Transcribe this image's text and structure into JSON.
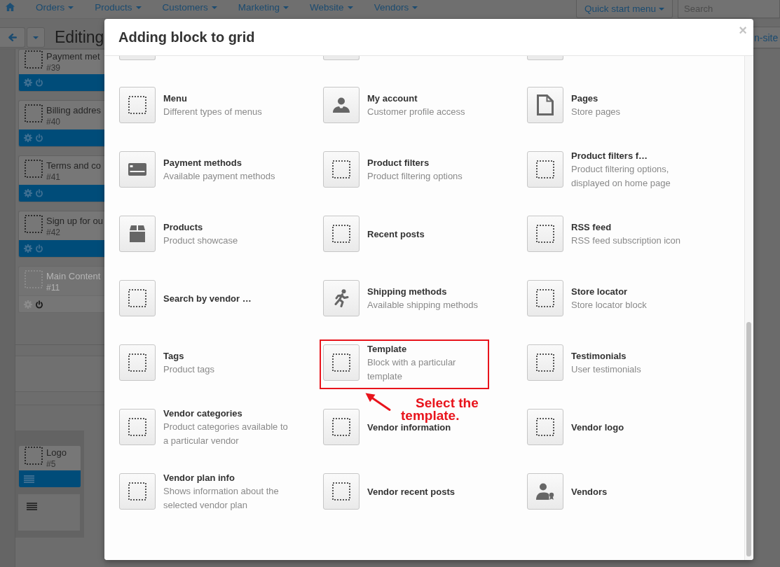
{
  "top_nav": {
    "menu": [
      {
        "label": "Orders"
      },
      {
        "label": "Products"
      },
      {
        "label": "Customers"
      },
      {
        "label": "Marketing"
      },
      {
        "label": "Website"
      },
      {
        "label": "Vendors"
      }
    ],
    "quick_start_menu": "Quick start menu",
    "search": {
      "placeholder": "Search"
    }
  },
  "toolbar": {
    "title": "Editing",
    "right_button": "n-site"
  },
  "layout_blocks": [
    {
      "title": "Payment met",
      "number": "#39",
      "enabled": true
    },
    {
      "title": "Billing addres",
      "number": "#40",
      "enabled": true
    },
    {
      "title": "Terms and co",
      "number": "#41",
      "enabled": true
    },
    {
      "title": "Sign up for ou",
      "number": "#42",
      "enabled": true
    },
    {
      "title": "Main Content",
      "number": "#11",
      "enabled": false
    }
  ],
  "footer_blocks": [
    {
      "title": "Logo",
      "number": "#5"
    }
  ],
  "dialog": {
    "title": "Adding block to grid",
    "close": "×",
    "blocks": [
      {
        "title": "Menu",
        "description": "Different types of menus",
        "kind": "placeholder",
        "highlighted": false
      },
      {
        "title": "My account",
        "description": "Customer profile access",
        "kind": "person",
        "highlighted": false
      },
      {
        "title": "Pages",
        "description": "Store pages",
        "kind": "page",
        "highlighted": false
      },
      {
        "title": "Payment methods",
        "description": "Available payment methods",
        "kind": "card",
        "highlighted": false
      },
      {
        "title": "Product filters",
        "description": "Product filtering options",
        "kind": "placeholder",
        "highlighted": false
      },
      {
        "title": "Product filters f…",
        "description": "Product filtering options, displayed on home page",
        "kind": "placeholder",
        "highlighted": false
      },
      {
        "title": "Products",
        "description": "Product showcase",
        "kind": "box",
        "highlighted": false
      },
      {
        "title": "Recent posts",
        "kind": "placeholder",
        "highlighted": false
      },
      {
        "title": "RSS feed",
        "description": "RSS feed subscription icon",
        "kind": "placeholder",
        "highlighted": false
      },
      {
        "title": "Search by vendor …",
        "kind": "placeholder",
        "highlighted": false
      },
      {
        "title": "Shipping methods",
        "description": "Available shipping methods",
        "kind": "runner",
        "highlighted": false
      },
      {
        "title": "Store locator",
        "description": "Store locator block",
        "kind": "placeholder",
        "highlighted": false
      },
      {
        "title": "Tags",
        "description": "Product tags",
        "kind": "placeholder",
        "highlighted": false
      },
      {
        "title": "Template",
        "description": "Block with a particular template",
        "kind": "placeholder",
        "highlighted": true
      },
      {
        "title": "Testimonials",
        "description": "User testimonials",
        "kind": "placeholder",
        "highlighted": false
      },
      {
        "title": "Vendor categories",
        "description": "Product categories available to a particular vendor",
        "kind": "placeholder",
        "highlighted": false
      },
      {
        "title": "Vendor information",
        "kind": "placeholder",
        "highlighted": false
      },
      {
        "title": "Vendor logo",
        "kind": "placeholder",
        "highlighted": false
      },
      {
        "title": "Vendor plan info",
        "description": "Shows information about the selected vendor plan",
        "kind": "placeholder",
        "highlighted": false
      },
      {
        "title": "Vendor recent posts",
        "kind": "placeholder",
        "highlighted": false
      },
      {
        "title": "Vendors",
        "kind": "vendor",
        "highlighted": false
      }
    ],
    "annotation": {
      "text": "Select the template."
    }
  }
}
